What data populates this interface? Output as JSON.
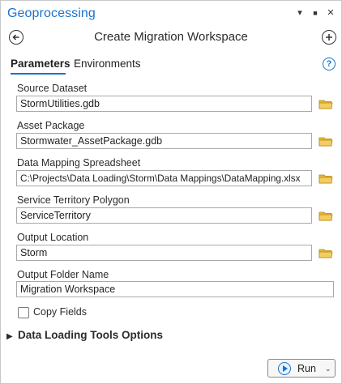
{
  "window": {
    "title": "Geoprocessing",
    "controls": {
      "pin": "▾",
      "maximize": "■",
      "close": "✕"
    }
  },
  "header": {
    "title": "Create Migration Workspace",
    "back_icon": "back-arrow-icon",
    "add_icon": "add-icon"
  },
  "tabs": [
    {
      "label": "Parameters",
      "active": true
    },
    {
      "label": "Environments",
      "active": false
    }
  ],
  "help": {
    "glyph": "?"
  },
  "params": [
    {
      "label": "Source Dataset",
      "value": "StormUtilities.gdb",
      "browse": true
    },
    {
      "label": "Asset Package",
      "value": "Stormwater_AssetPackage.gdb",
      "browse": true
    },
    {
      "label": "Data Mapping Spreadsheet",
      "value": "C:\\Projects\\Data Loading\\Storm\\Data Mappings\\DataMapping.xlsx",
      "browse": true
    },
    {
      "label": "Service Territory Polygon",
      "value": "ServiceTerritory",
      "browse": true
    },
    {
      "label": "Output Location",
      "value": "Storm",
      "browse": true
    },
    {
      "label": "Output Folder Name",
      "value": "Migration Workspace",
      "browse": false
    }
  ],
  "copy_fields": {
    "label": "Copy Fields",
    "checked": false
  },
  "group": {
    "label": "Data Loading Tools Options",
    "expanded": false,
    "chevron": "▶"
  },
  "run": {
    "label": "Run",
    "dropdown": "⌄"
  },
  "colors": {
    "accent": "#1a73c8",
    "folder": "#e8b73c"
  }
}
